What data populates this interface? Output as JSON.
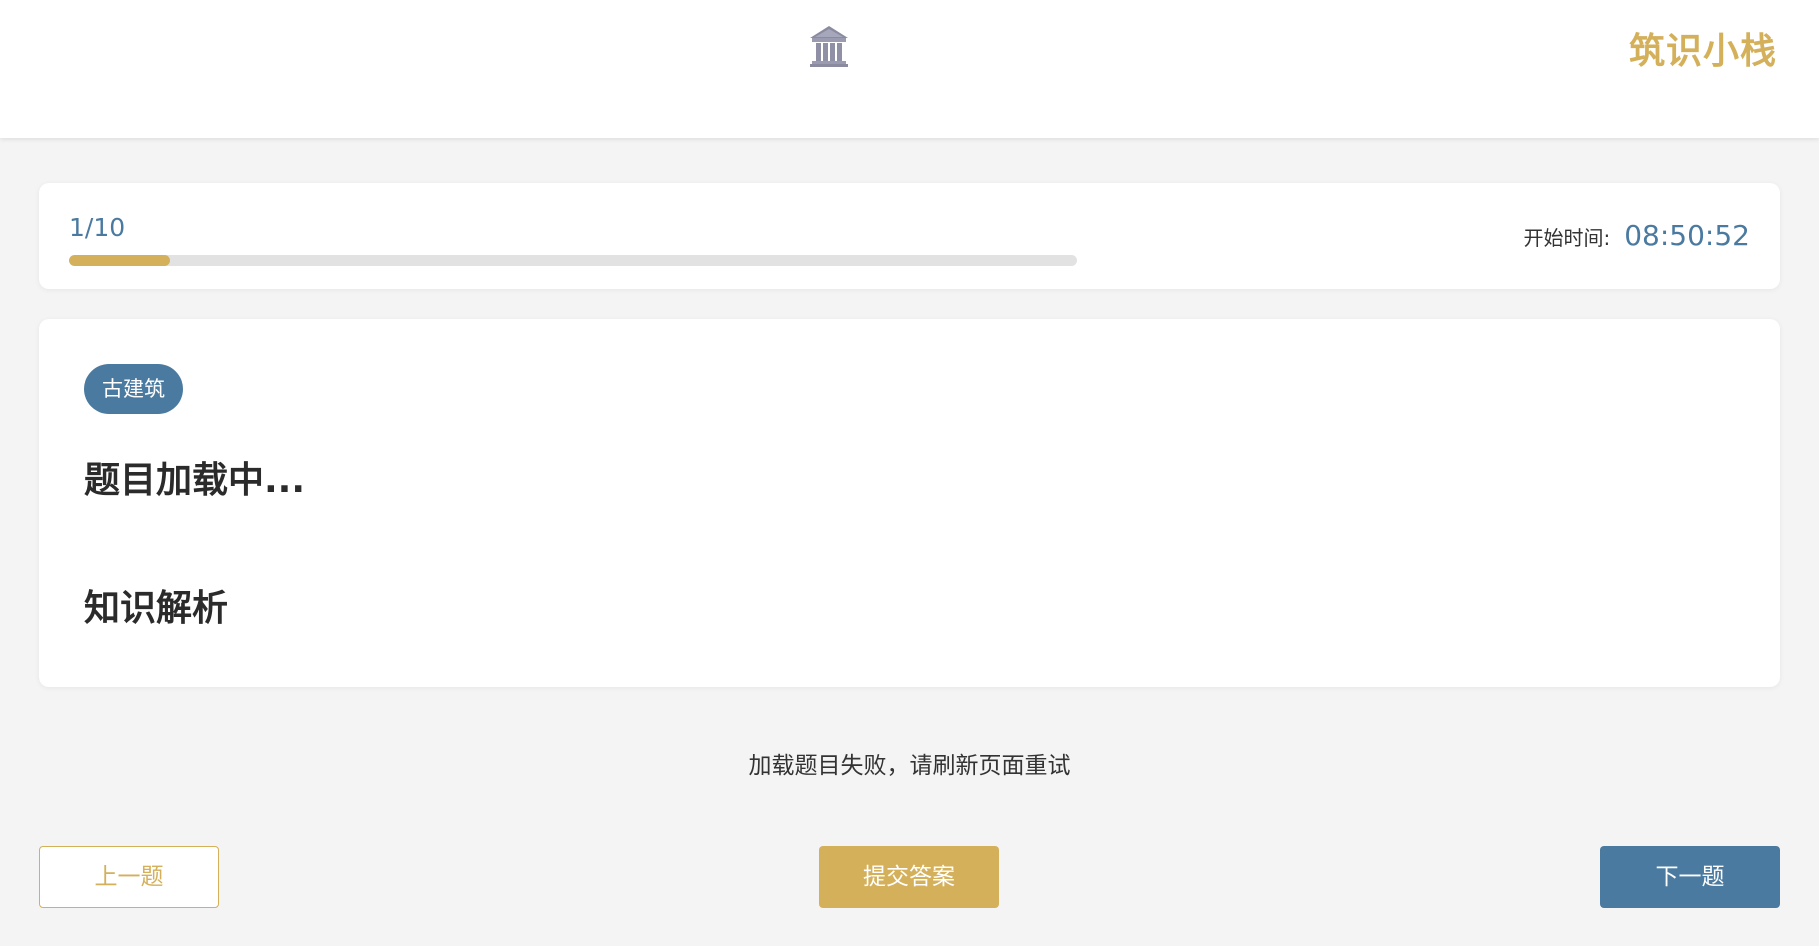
{
  "header": {
    "logo_icon": "classical-building-icon",
    "brand": "筑识小栈"
  },
  "progress": {
    "count": "1/10",
    "current": 1,
    "total": 10,
    "fill_fraction": 0.1,
    "timer_label": "开始时间:",
    "timer_value": "08:50:52"
  },
  "question": {
    "tag": "古建筑",
    "title": "题目加载中...",
    "analysis_title": "知识解析"
  },
  "status": {
    "error_message": "加载题目失败，请刷新页面重试"
  },
  "buttons": {
    "prev": "上一题",
    "submit": "提交答案",
    "next": "下一题"
  },
  "colors": {
    "accent_gold": "#d4b05a",
    "accent_blue": "#4a7aa0",
    "background": "#f4f4f4"
  }
}
